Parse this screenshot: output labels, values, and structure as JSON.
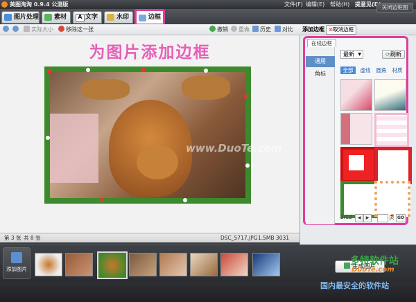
{
  "app": {
    "title": "美图淘淘 0.9.4 公测版",
    "menus": [
      "文件(F)",
      "编辑(E)",
      "帮助(H)",
      "提意见(D)"
    ]
  },
  "tabs": [
    {
      "label": "图片处理"
    },
    {
      "label": "素材"
    },
    {
      "label": "文字"
    },
    {
      "label": "水印"
    },
    {
      "label": "边框"
    }
  ],
  "close_all_label": "关闭边框图",
  "toolbar": {
    "actual_size": "实际大小",
    "remove_one": "移除这一张",
    "undo": "撤销",
    "redo": "重做",
    "history": "历史",
    "compare": "对比"
  },
  "canvas": {
    "title": "为图片添加边框",
    "watermark": "www.DuoTe.com"
  },
  "status": {
    "current": "第 3 张",
    "total": "共 8 张",
    "file": "DSC_5717.JPG",
    "size": "1.5MB 3031"
  },
  "panel": {
    "title": "添加边框",
    "cancel_label": "取消边框",
    "online_tab": "在线边框",
    "categories": [
      "通用",
      "角标"
    ],
    "sort": "最新",
    "refresh": "刷新",
    "filters": [
      "全部",
      "虚线",
      "圆角",
      "材质"
    ],
    "page": "2/12",
    "page_unit": "页",
    "go": "GO"
  },
  "film": {
    "add_label": "添加图片",
    "generate_label": "生成图片"
  },
  "watermarks": {
    "site1": "多特软件站",
    "site2": "DuoTe.com",
    "bottom": "国内最安全的软件站"
  },
  "colors": {
    "highlight": "#e03d9c",
    "title_pink": "#e65fb8",
    "selected_blue": "#4a8ad6"
  }
}
